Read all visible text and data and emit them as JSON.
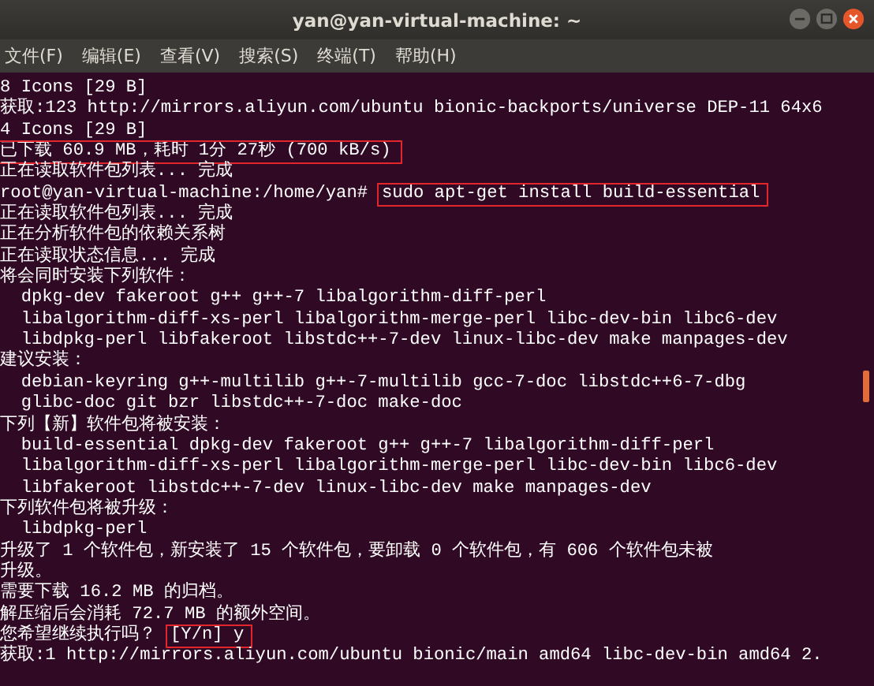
{
  "window": {
    "title": "yan@yan-virtual-machine: ~"
  },
  "menu": [
    "文件(F)",
    "编辑(E)",
    "查看(V)",
    "搜索(S)",
    "终端(T)",
    "帮助(H)"
  ],
  "terminal": {
    "lines": [
      {
        "text": "8 Icons [29 B]"
      },
      {
        "text": "获取:123 http://mirrors.aliyun.com/ubuntu bionic-backports/universe DEP-11 64x6"
      },
      {
        "text": "4 Icons [29 B]"
      },
      {
        "highlight": "已下载 60.9 MB，耗时 1分 27秒 (700 kB/s)"
      },
      {
        "text": "正在读取软件包列表... 完成"
      },
      {
        "text": "root@yan-virtual-machine:/home/yan#",
        "highlight": "sudo apt-get install build-essential"
      },
      {
        "text": "正在读取软件包列表... 完成"
      },
      {
        "text": "正在分析软件包的依赖关系树"
      },
      {
        "text": "正在读取状态信息... 完成"
      },
      {
        "text": "将会同时安装下列软件："
      },
      {
        "text": "  dpkg-dev fakeroot g++ g++-7 libalgorithm-diff-perl"
      },
      {
        "text": "  libalgorithm-diff-xs-perl libalgorithm-merge-perl libc-dev-bin libc6-dev"
      },
      {
        "text": "  libdpkg-perl libfakeroot libstdc++-7-dev linux-libc-dev make manpages-dev"
      },
      {
        "text": "建议安装："
      },
      {
        "text": "  debian-keyring g++-multilib g++-7-multilib gcc-7-doc libstdc++6-7-dbg"
      },
      {
        "text": "  glibc-doc git bzr libstdc++-7-doc make-doc"
      },
      {
        "text": "下列【新】软件包将被安装："
      },
      {
        "text": "  build-essential dpkg-dev fakeroot g++ g++-7 libalgorithm-diff-perl"
      },
      {
        "text": "  libalgorithm-diff-xs-perl libalgorithm-merge-perl libc-dev-bin libc6-dev"
      },
      {
        "text": "  libfakeroot libstdc++-7-dev linux-libc-dev make manpages-dev"
      },
      {
        "text": "下列软件包将被升级："
      },
      {
        "text": "  libdpkg-perl"
      },
      {
        "text": "升级了 1 个软件包，新安装了 15 个软件包，要卸载 0 个软件包，有 606 个软件包未被"
      },
      {
        "text": "升级。"
      },
      {
        "text": "需要下载 16.2 MB 的归档。"
      },
      {
        "text": "解压缩后会消耗 72.7 MB 的额外空间。"
      },
      {
        "text": "您希望继续执行吗？",
        "highlight": "[Y/n] y"
      },
      {
        "text": "获取:1 http://mirrors.aliyun.com/ubuntu bionic/main amd64 libc-dev-bin amd64 2."
      }
    ]
  }
}
